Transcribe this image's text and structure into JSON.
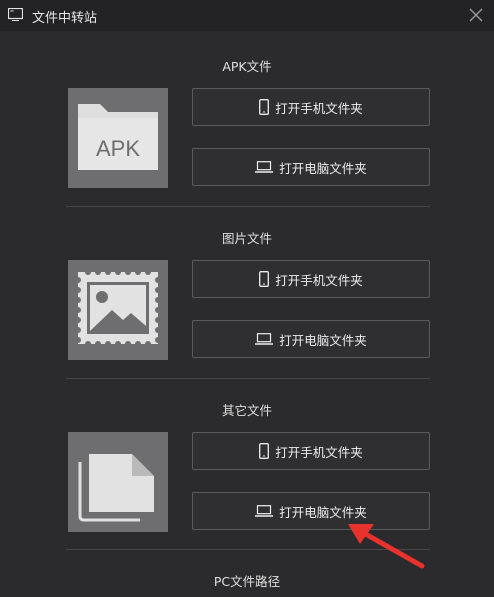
{
  "window": {
    "title": "文件中转站"
  },
  "sections": [
    {
      "title": "APK文件",
      "tile_label": "APK",
      "tile_icon": "apk-folder-icon",
      "buttons": [
        {
          "label": "打开手机文件夹",
          "icon": "phone-icon"
        },
        {
          "label": "打开电脑文件夹",
          "icon": "laptop-icon"
        }
      ]
    },
    {
      "title": "图片文件",
      "tile_icon": "image-icon",
      "buttons": [
        {
          "label": "打开手机文件夹",
          "icon": "phone-icon"
        },
        {
          "label": "打开电脑文件夹",
          "icon": "laptop-icon"
        }
      ]
    },
    {
      "title": "其它文件",
      "tile_icon": "documents-icon",
      "buttons": [
        {
          "label": "打开手机文件夹",
          "icon": "phone-icon"
        },
        {
          "label": "打开电脑文件夹",
          "icon": "laptop-icon"
        }
      ]
    }
  ],
  "pc_path": {
    "title": "PC文件路径"
  },
  "colors": {
    "background": "#2b2b2d",
    "tile": "#6e6e70",
    "arrow": "#e8322d"
  }
}
